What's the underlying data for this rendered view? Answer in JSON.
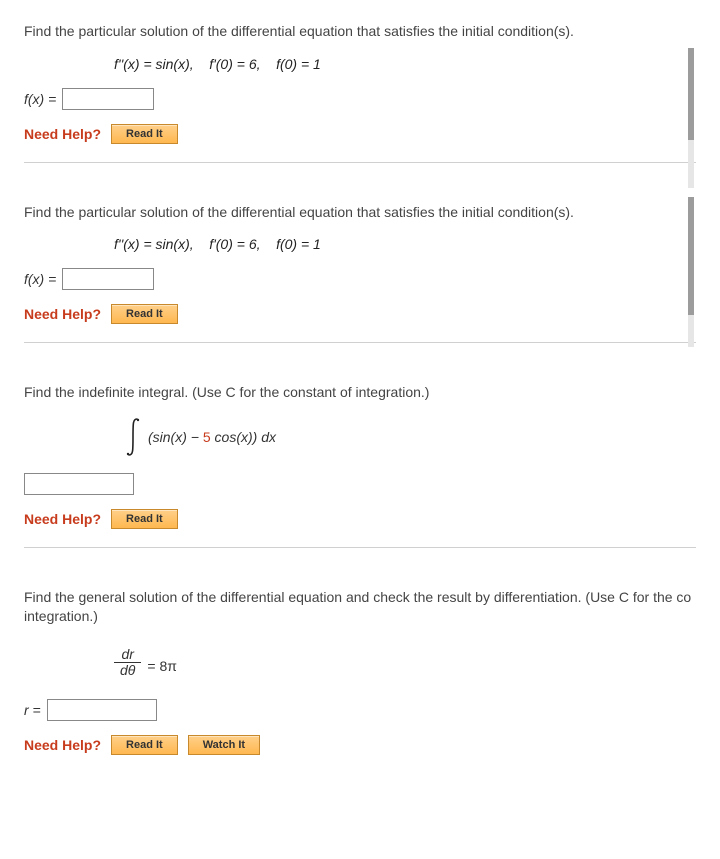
{
  "buttons": {
    "read": "Read It",
    "watch": "Watch It"
  },
  "help_label": "Need Help?",
  "q1": {
    "prompt": "Find the particular solution of the differential equation that satisfies the initial condition(s).",
    "eq_left": "f''(x) = sin(x),",
    "eq_mid": "f'(0) = 6,",
    "eq_right": "f(0) = 1",
    "answer_label": "f(x) ="
  },
  "q2": {
    "prompt": "Find the particular solution of the differential equation that satisfies the initial condition(s).",
    "eq_left": "f''(x) = sin(x),",
    "eq_mid": "f'(0) = 6,",
    "eq_right": "f(0) = 1",
    "answer_label": "f(x) ="
  },
  "q3": {
    "prompt": "Find the indefinite integral. (Use C for the constant of integration.)",
    "integrand_a": "(sin(x) − ",
    "integrand_coef": "5",
    "integrand_b": " cos(x)) dx"
  },
  "q4": {
    "prompt": "Find the general solution of the differential equation and check the result by differentiation. (Use C for the co integration.)",
    "frac_num": "dr",
    "frac_den": "dθ",
    "rhs": " = 8π",
    "answer_label": "r ="
  }
}
